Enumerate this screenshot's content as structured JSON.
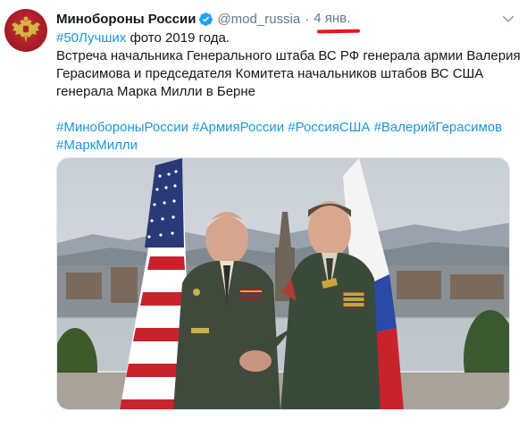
{
  "tweet": {
    "display_name": "Минобороны России",
    "handle": "@mod_russia",
    "separator": "·",
    "date": "4 янв.",
    "text": {
      "line1_hashtag": "#50Лучших",
      "line1_rest": " фото 2019 года.",
      "line2": "Встреча начальника Генерального штаба ВС РФ генерала армии Валерия",
      "line3": "Герасимова и председателя Комитета начальников штабов ВС США",
      "line4": "генерала Марка Милли в Берне",
      "hashtags_line1": [
        "#МинобороныРоссии",
        "#АрмияРоссии",
        "#РоссияСША",
        "#ВалерийГерасимов"
      ],
      "hashtags_line2": [
        "#МаркМилли"
      ]
    }
  },
  "colors": {
    "link": "#1b95e0",
    "verified": "#1da1f2",
    "secondary_text": "#657786",
    "annotation_underline": "#e6171a"
  },
  "icons": {
    "avatar": "ministry-of-defense-emblem",
    "verified": "verified-badge-icon",
    "caret": "chevron-down-icon"
  }
}
